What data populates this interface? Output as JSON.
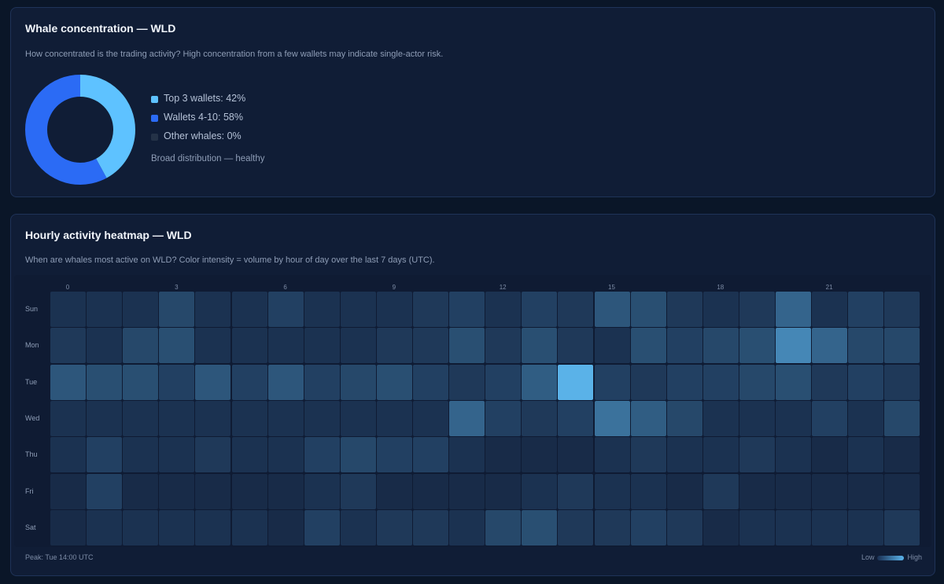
{
  "concentration": {
    "title": "Whale concentration — WLD",
    "subtitle": "How concentrated is the trading activity? High concentration from a few wallets may indicate single-actor risk.",
    "legend": [
      {
        "label": "Top 3 wallets: 42%",
        "value": 42,
        "color": "#5ec2ff"
      },
      {
        "label": "Wallets 4-10: 58%",
        "value": 58,
        "color": "#2b6bf5"
      },
      {
        "label": "Other whales: 0%",
        "value": 0,
        "color": "#243247"
      }
    ],
    "note": "Broad distribution — healthy"
  },
  "heatmap": {
    "title": "Hourly activity heatmap — WLD",
    "subtitle": "When are whales most active on WLD? Color intensity = volume by hour of day over the last 7 days (UTC).",
    "hour_labels": [
      "0",
      "3",
      "6",
      "9",
      "12",
      "15",
      "18",
      "21"
    ],
    "days": [
      "Sun",
      "Mon",
      "Tue",
      "Wed",
      "Thu",
      "Fri",
      "Sat"
    ],
    "peak_text": "Peak: Tue 14:00 UTC",
    "scale_low": "Low",
    "scale_high": "High"
  },
  "chart_data": [
    {
      "type": "pie",
      "labels": [
        "Top 3 wallets",
        "Wallets 4-10",
        "Other whales"
      ],
      "values": [
        42,
        58,
        0
      ]
    },
    {
      "type": "heatmap",
      "x": [
        0,
        1,
        2,
        3,
        4,
        5,
        6,
        7,
        8,
        9,
        10,
        11,
        12,
        13,
        14,
        15,
        16,
        17,
        18,
        19,
        20,
        21,
        22,
        23
      ],
      "y": [
        "Sun",
        "Mon",
        "Tue",
        "Wed",
        "Thu",
        "Fri",
        "Sat"
      ],
      "values": [
        [
          0.1,
          0.1,
          0.1,
          0.25,
          0.1,
          0.1,
          0.2,
          0.1,
          0.1,
          0.1,
          0.15,
          0.2,
          0.1,
          0.2,
          0.15,
          0.35,
          0.3,
          0.15,
          0.1,
          0.15,
          0.45,
          0.1,
          0.2,
          0.15
        ],
        [
          0.15,
          0.1,
          0.25,
          0.3,
          0.1,
          0.1,
          0.1,
          0.1,
          0.1,
          0.15,
          0.15,
          0.3,
          0.15,
          0.3,
          0.15,
          0.1,
          0.3,
          0.2,
          0.25,
          0.3,
          0.7,
          0.45,
          0.25,
          0.25
        ],
        [
          0.35,
          0.3,
          0.3,
          0.2,
          0.35,
          0.2,
          0.35,
          0.2,
          0.25,
          0.3,
          0.2,
          0.15,
          0.2,
          0.4,
          1.0,
          0.2,
          0.15,
          0.2,
          0.2,
          0.25,
          0.3,
          0.15,
          0.2,
          0.15
        ],
        [
          0.1,
          0.1,
          0.1,
          0.1,
          0.1,
          0.1,
          0.1,
          0.1,
          0.1,
          0.1,
          0.1,
          0.45,
          0.2,
          0.15,
          0.2,
          0.55,
          0.4,
          0.25,
          0.1,
          0.1,
          0.1,
          0.2,
          0.1,
          0.25
        ],
        [
          0.1,
          0.2,
          0.1,
          0.1,
          0.15,
          0.1,
          0.1,
          0.2,
          0.25,
          0.2,
          0.2,
          0.1,
          0.05,
          0.05,
          0.05,
          0.1,
          0.15,
          0.1,
          0.1,
          0.15,
          0.1,
          0.05,
          0.1,
          0.05
        ],
        [
          0.05,
          0.2,
          0.05,
          0.05,
          0.05,
          0.05,
          0.05,
          0.1,
          0.15,
          0.05,
          0.05,
          0.05,
          0.05,
          0.1,
          0.15,
          0.1,
          0.1,
          0.05,
          0.15,
          0.05,
          0.05,
          0.05,
          0.05,
          0.05
        ],
        [
          0.05,
          0.1,
          0.1,
          0.1,
          0.1,
          0.1,
          0.05,
          0.2,
          0.1,
          0.15,
          0.15,
          0.1,
          0.25,
          0.3,
          0.15,
          0.15,
          0.2,
          0.15,
          0.05,
          0.1,
          0.1,
          0.1,
          0.1,
          0.15
        ]
      ]
    }
  ]
}
